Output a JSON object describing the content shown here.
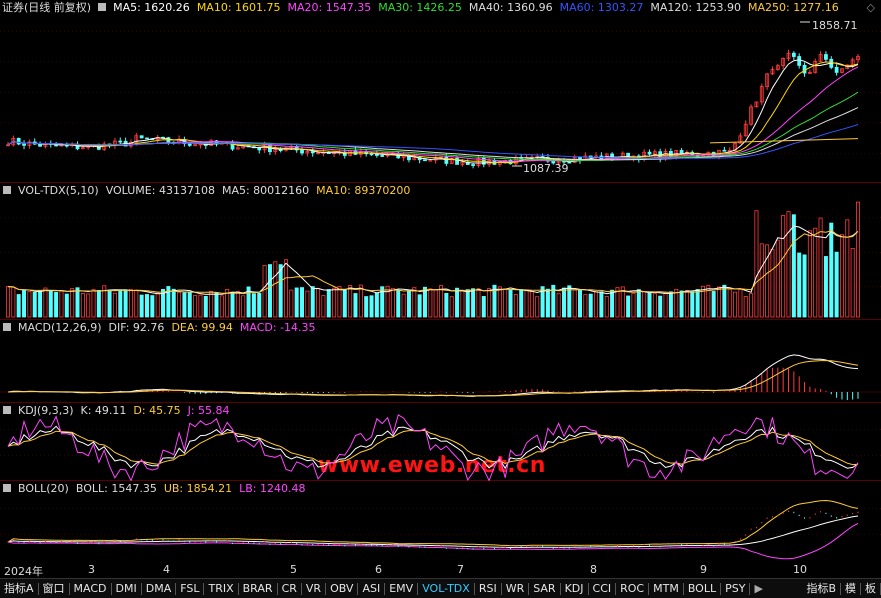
{
  "main": {
    "title": "证券(日线 前复权)",
    "ma": [
      {
        "label": "MA5: 1620.26",
        "color": "#ffffff"
      },
      {
        "label": "MA10: 1601.75",
        "color": "#ffd700"
      },
      {
        "label": "MA20: 1547.35",
        "color": "#ff44ff"
      },
      {
        "label": "MA30: 1426.25",
        "color": "#33dd33"
      },
      {
        "label": "MA40: 1360.96",
        "color": "#dddddd"
      },
      {
        "label": "MA60: 1303.27",
        "color": "#3355ff"
      },
      {
        "label": "MA120: 1253.90",
        "color": "#dddddd"
      },
      {
        "label": "MA250: 1277.16",
        "color": "#ffcc33"
      }
    ],
    "high_label": "1858.71",
    "low_label": "1087.39",
    "diamond": "◇"
  },
  "volume": {
    "name": "VOL-TDX(5,10)",
    "items": [
      {
        "label": "VOLUME: 43137108",
        "color": "#dddddd"
      },
      {
        "label": "MA5: 80012160",
        "color": "#dddddd"
      },
      {
        "label": "MA10: 89370200",
        "color": "#ffcc33"
      }
    ]
  },
  "macd": {
    "name": "MACD(12,26,9)",
    "items": [
      {
        "label": "DIF: 92.76",
        "color": "#dddddd"
      },
      {
        "label": "DEA: 99.94",
        "color": "#ffcc33"
      },
      {
        "label": "MACD: -14.35",
        "color": "#ff44ff"
      }
    ]
  },
  "kdj": {
    "name": "KDJ(9,3,3)",
    "items": [
      {
        "label": "K: 49.11",
        "color": "#dddddd"
      },
      {
        "label": "D: 45.75",
        "color": "#ffcc33"
      },
      {
        "label": "J: 55.84",
        "color": "#ff44ff"
      }
    ]
  },
  "boll": {
    "name": "BOLL(20)",
    "items": [
      {
        "label": "BOLL: 1547.35",
        "color": "#dddddd"
      },
      {
        "label": "UB: 1854.21",
        "color": "#ffcc33"
      },
      {
        "label": "LB: 1240.48",
        "color": "#ff44ff"
      }
    ]
  },
  "x_axis": [
    "2024年",
    "3",
    "4",
    "5",
    "6",
    "7",
    "8",
    "9",
    "10"
  ],
  "watermark": "www.eweb.net.cn",
  "tabs": [
    "指标A",
    "窗口",
    "MACD",
    "DMI",
    "DMA",
    "FSL",
    "TRIX",
    "BRAR",
    "CR",
    "VR",
    "OBV",
    "ASI",
    "EMV",
    "VOL-TDX",
    "RSI",
    "WR",
    "SAR",
    "KDJ",
    "CCI",
    "ROC",
    "MTM",
    "BOLL",
    "PSY"
  ],
  "active_tab": "VOL-TDX",
  "right_tabs": [
    "指标B",
    "模",
    "板"
  ],
  "more_arrow": "▶"
}
